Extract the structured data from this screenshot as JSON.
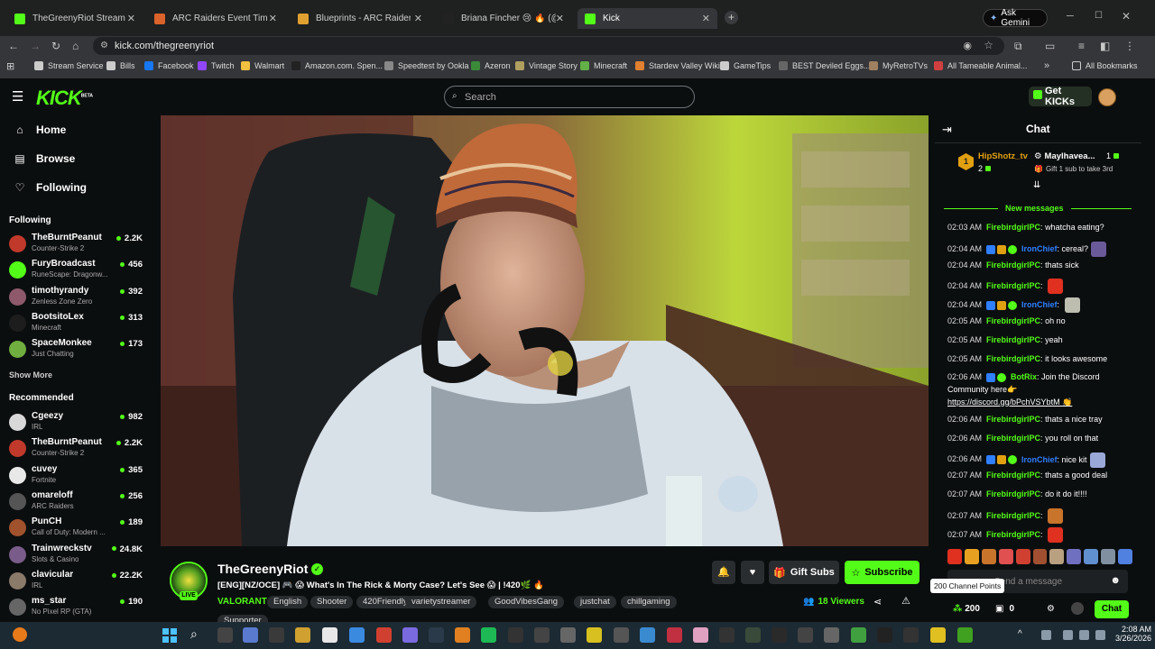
{
  "browser": {
    "tabs": [
      {
        "label": "TheGreenyRiot Stream - Wa",
        "color": "#53fc18",
        "active": false
      },
      {
        "label": "ARC Raiders Event Timers | Met",
        "color": "#d9632a",
        "active": false
      },
      {
        "label": "Blueprints - ARC Raiders Wiki",
        "color": "#e0a030",
        "active": false
      },
      {
        "label": "Briana Fincher 😢 🔥 (@firebird",
        "color": "#222222",
        "active": false
      },
      {
        "label": "Kick",
        "color": "#53fc18",
        "active": true
      }
    ],
    "ask_gemini": "Ask Gemini",
    "url": "kick.com/thegreenyriot",
    "bookmarks": [
      "Stream Service",
      "Bills",
      "Facebook",
      "Twitch",
      "Walmart",
      "Amazon.com. Spen...",
      "Speedtest by Ookla",
      "Azeron",
      "Vintage Story",
      "Minecraft",
      "Stardew Valley Wiki",
      "GameTips",
      "BEST Deviled Eggs...",
      "MyRetroTVs",
      "All Tameable Animal..."
    ],
    "all_bookmarks": "All Bookmarks"
  },
  "kick": {
    "logo": "KICK",
    "logo_beta": "BETA",
    "search_placeholder": "Search",
    "get_kicks": "Get KICKs"
  },
  "sidebar": {
    "nav": [
      "Home",
      "Browse",
      "Following"
    ],
    "following_heading": "Following",
    "following": [
      {
        "name": "TheBurntPeanut",
        "game": "Counter-Strike 2",
        "viewers": "2.2K",
        "color": "#c0392b"
      },
      {
        "name": "FuryBroadcast",
        "game": "RuneScape: Dragonw...",
        "viewers": "456",
        "color": "#53fc18"
      },
      {
        "name": "timothyrandy",
        "game": "Zenless Zone Zero",
        "viewers": "392",
        "color": "#8e5a6b"
      },
      {
        "name": "BootsitoLex",
        "game": "Minecraft",
        "viewers": "313",
        "color": "#1d1d1d"
      },
      {
        "name": "SpaceMonkee",
        "game": "Just Chatting",
        "viewers": "173",
        "color": "#6fae3f"
      }
    ],
    "show_more": "Show More",
    "recommended_heading": "Recommended",
    "recommended": [
      {
        "name": "Cgeezy",
        "game": "IRL",
        "viewers": "982",
        "color": "#d8d8d8"
      },
      {
        "name": "TheBurntPeanut",
        "game": "Counter-Strike 2",
        "viewers": "2.2K",
        "color": "#c0392b"
      },
      {
        "name": "cuvey",
        "game": "Fortnite",
        "viewers": "365",
        "color": "#e8e8e8"
      },
      {
        "name": "omareloff",
        "game": "ARC Raiders",
        "viewers": "256",
        "color": "#555555"
      },
      {
        "name": "PunCH",
        "game": "Call of Duty: Modern ...",
        "viewers": "189",
        "color": "#a0522d"
      },
      {
        "name": "Trainwreckstv",
        "game": "Slots & Casino",
        "viewers": "24.8K",
        "color": "#7a5c8a"
      },
      {
        "name": "clavicular",
        "game": "IRL",
        "viewers": "22.2K",
        "color": "#8a7a6a"
      },
      {
        "name": "ms_star",
        "game": "No Pixel RP (GTA)",
        "viewers": "190",
        "color": "#666666"
      }
    ]
  },
  "stream": {
    "channel": "TheGreenyRiot",
    "live": "LIVE",
    "title": "[ENG][NZ/OCE] 🎮 😱 What's In The Rick & Morty Case? Let's See 😱 | !420🌿 🔥",
    "category": "VALORANT",
    "tags": [
      "English",
      "Shooter",
      "420Friendly",
      "varietystreamer",
      "GoodVibesGang",
      "justchat",
      "chillgaming",
      "Supporter"
    ],
    "viewers": "18",
    "viewers_label": "Viewers",
    "gift_subs": "Gift Subs",
    "subscribe": "Subscribe"
  },
  "chat": {
    "title": "Chat",
    "gifter1_name": "HipShotz_tv",
    "gifter1_rank": "1",
    "gifter1_count": "2",
    "gifter2_name": "Maylhavea...",
    "gifter2_count": "1",
    "gifter2_note": "Gift 1 sub to take 3rd",
    "new_messages": "New messages",
    "messages": [
      {
        "time": "02:03 AM",
        "user": "FirebirdgirlPC",
        "text": "whatcha eating?",
        "blue": false,
        "badges": false,
        "emote": ""
      },
      {
        "time": "02:04 AM",
        "user": "IronChief",
        "text": "cereal?",
        "blue": true,
        "badges": true,
        "emote": "#6b5a9a"
      },
      {
        "time": "02:04 AM",
        "user": "FirebirdgirlPC",
        "text": "thats sick",
        "blue": false,
        "badges": false,
        "emote": ""
      },
      {
        "time": "02:04 AM",
        "user": "FirebirdgirlPC",
        "text": "",
        "blue": false,
        "badges": false,
        "emote": "#e03020"
      },
      {
        "time": "02:04 AM",
        "user": "IronChief",
        "text": "",
        "blue": true,
        "badges": true,
        "emote": "#bdbdb0"
      },
      {
        "time": "02:05 AM",
        "user": "FirebirdgirlPC",
        "text": "oh no",
        "blue": false,
        "badges": false,
        "emote": ""
      },
      {
        "time": "02:05 AM",
        "user": "FirebirdgirlPC",
        "text": "yeah",
        "blue": false,
        "badges": false,
        "emote": ""
      },
      {
        "time": "02:05 AM",
        "user": "FirebirdgirlPC",
        "text": "it looks awesome",
        "blue": false,
        "badges": false,
        "emote": ""
      }
    ],
    "botrix_time": "02:06 AM",
    "botrix_user": "BotRix",
    "botrix_text1": "Join the Discord",
    "botrix_text2": "Community here👉",
    "botrix_link": "https://discord.gg/bPchVSYbtM",
    "messages2": [
      {
        "time": "02:06 AM",
        "user": "FirebirdgirlPC",
        "text": "thats a nice tray",
        "blue": false,
        "badges": false,
        "emote": ""
      },
      {
        "time": "02:06 AM",
        "user": "FirebirdgirlPC",
        "text": "you roll on that",
        "blue": false,
        "badges": false,
        "emote": ""
      },
      {
        "time": "02:06 AM",
        "user": "IronChief",
        "text": "nice kit",
        "blue": true,
        "badges": true,
        "emote": "#9aa8d8"
      },
      {
        "time": "02:07 AM",
        "user": "FirebirdgirlPC",
        "text": "thats a good deal",
        "blue": false,
        "badges": false,
        "emote": ""
      },
      {
        "time": "02:07 AM",
        "user": "FirebirdgirlPC",
        "text": "do it do it!!!!",
        "blue": false,
        "badges": false,
        "emote": ""
      },
      {
        "time": "02:07 AM",
        "user": "FirebirdgirlPC",
        "text": "",
        "blue": false,
        "badges": false,
        "emote": "#c8742a"
      },
      {
        "time": "02:07 AM",
        "user": "FirebirdgirlPC",
        "text": "",
        "blue": false,
        "badges": false,
        "emote": "#e03020"
      }
    ],
    "send_placeholder": "Send a message",
    "tooltip": "200 Channel Points",
    "points": "200",
    "gifts": "0",
    "chat_button": "Chat"
  },
  "taskbar": {
    "time": "2:08 AM",
    "date": "3/26/2026"
  },
  "colors": {
    "accent": "#53fc18",
    "bg": "#0b0e0f",
    "blue_user": "#2f7fff"
  }
}
